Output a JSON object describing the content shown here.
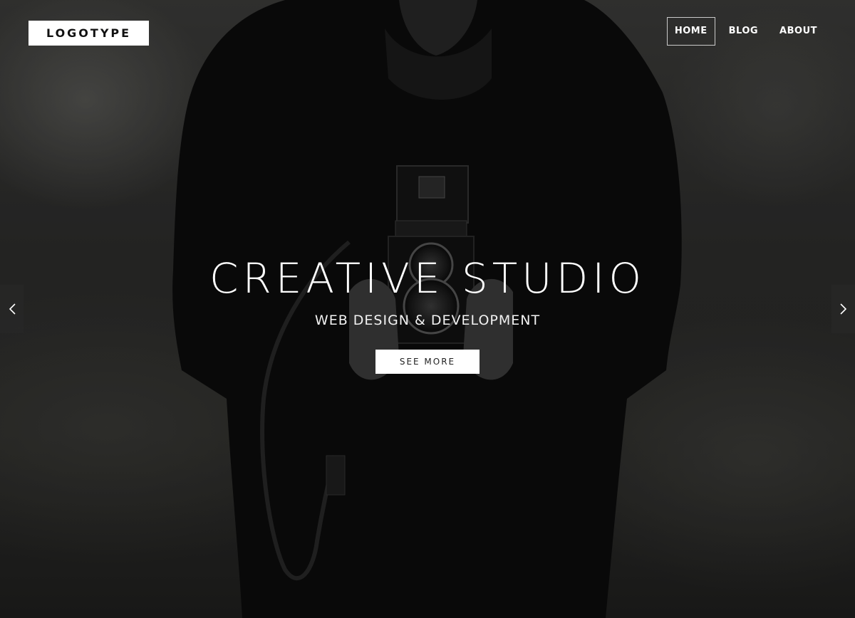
{
  "header": {
    "logo_text": "LOGOTYPE",
    "nav": [
      {
        "label": "HOME",
        "active": true
      },
      {
        "label": "BLOG",
        "active": false
      },
      {
        "label": "ABOUT",
        "active": false
      }
    ]
  },
  "hero": {
    "title": "CREATIVE STUDIO",
    "subtitle": "WEB DESIGN & DEVELOPMENT",
    "cta_label": "SEE MORE"
  },
  "slider": {
    "prev_icon": "chevron-left-icon",
    "next_icon": "chevron-right-icon"
  },
  "colors": {
    "text": "#ffffff",
    "button_bg": "#ffffff",
    "button_text": "#222222"
  }
}
